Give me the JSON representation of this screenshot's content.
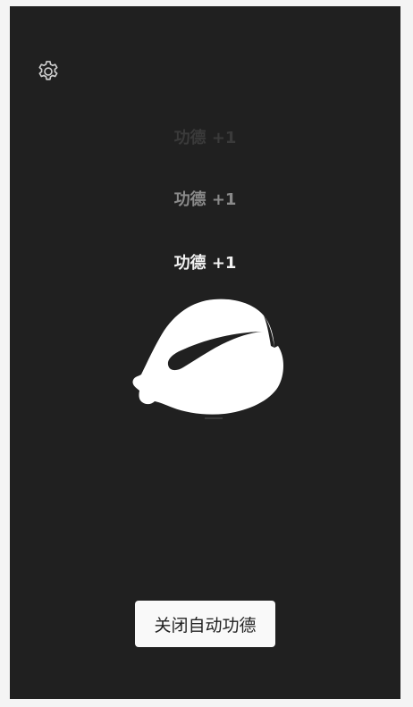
{
  "merit_popups": [
    {
      "text": "功德 +1"
    },
    {
      "text": "功德 +1"
    },
    {
      "text": "功德 +1"
    }
  ],
  "icons": {
    "settings": "gear-icon",
    "woodfish": "wooden-fish-icon"
  },
  "auto_merit_button": {
    "label": "关闭自动功德"
  },
  "colors": {
    "background": "#202020",
    "page_border": "#f4f4f4",
    "text_bright": "#f2f2f2",
    "text_mid": "#8a8a8a",
    "text_faded": "#3a3a3a",
    "button_bg": "#f9f9f9"
  }
}
